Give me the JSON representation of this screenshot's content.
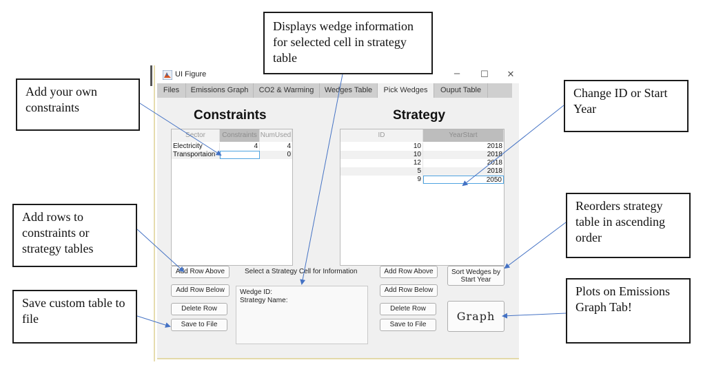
{
  "window": {
    "title": "UI Figure",
    "controls": [
      "minimize-icon",
      "maximize-icon",
      "close-icon"
    ],
    "control_glyphs": [
      "–",
      "☐",
      "✕"
    ]
  },
  "tabs": [
    {
      "label": "Files",
      "active": false
    },
    {
      "label": "Emissions Graph",
      "active": false
    },
    {
      "label": "CO2 & Warming",
      "active": false
    },
    {
      "label": "Wedges Table",
      "active": false
    },
    {
      "label": "Pick Wedges",
      "active": true
    },
    {
      "label": "Ouput Table",
      "active": false
    }
  ],
  "constraints": {
    "heading": "Constraints",
    "columns": [
      "Sector",
      "Constraints",
      "NumUsed"
    ],
    "rows": [
      {
        "sector": "Electricity",
        "constraints": "4",
        "num_used": "4"
      },
      {
        "sector": "Transportaion",
        "constraints": "",
        "num_used": "0"
      }
    ],
    "buttons": {
      "add_above": "Add Row Above",
      "add_below": "Add Row Below",
      "delete": "Delete Row",
      "save": "Save to File"
    }
  },
  "strategy": {
    "heading": "Strategy",
    "columns": [
      "ID",
      "YearStart"
    ],
    "rows": [
      {
        "id": "10",
        "year_start": "2018"
      },
      {
        "id": "10",
        "year_start": "2018"
      },
      {
        "id": "12",
        "year_start": "2018"
      },
      {
        "id": "5",
        "year_start": "2018"
      },
      {
        "id": "9",
        "year_start": "2050"
      }
    ],
    "buttons": {
      "add_above": "Add Row Above",
      "add_below": "Add Row Below",
      "delete": "Delete Row",
      "save": "Save to File",
      "sort": "Sort Wedges by Start Year",
      "graph": "Graph"
    }
  },
  "info_panel": {
    "label": "Select a Strategy Cell for Information",
    "lines": [
      "Wedge ID:",
      "Strategy Name:"
    ]
  },
  "callouts": {
    "own_constraints": "Add your own constraints",
    "displays_wedge": "Displays wedge information for selected cell in strategy table",
    "change_id": "Change ID or Start Year",
    "add_rows": "Add rows to constraints or strategy tables",
    "reorders": "Reorders strategy table in ascending order",
    "save_custom": "Save custom table to file",
    "plots_on": "Plots on Emissions Graph Tab!"
  },
  "colors": {
    "arrow": "#4472c4",
    "selection": "#4da3e0",
    "selected_header": "#bdbdbd",
    "window_bg": "#f0f0f0"
  }
}
